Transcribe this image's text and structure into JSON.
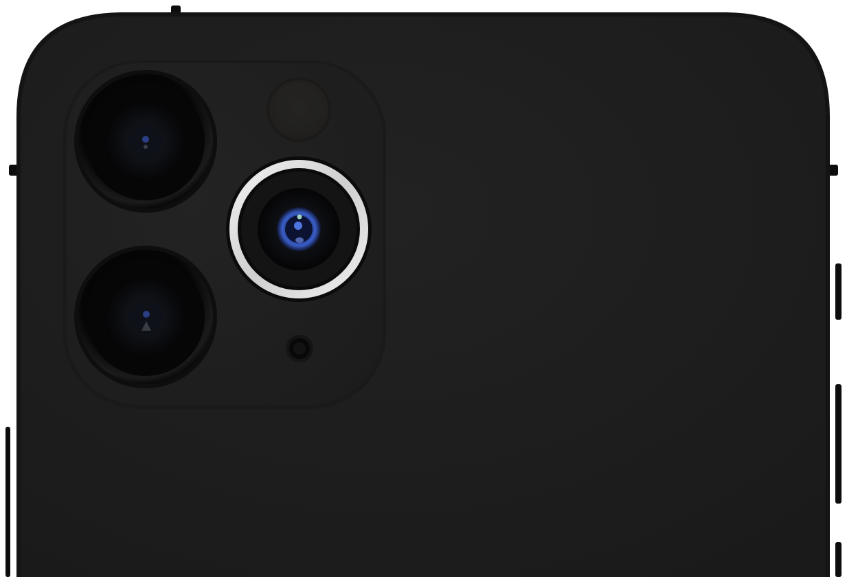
{
  "subject": {
    "kind": "smartphone-rear",
    "camera_count": 3,
    "has_flash": true,
    "has_microphone": true
  },
  "colors": {
    "background": "#ffffff",
    "body": "#1f1f1f",
    "body_edge": "#171717",
    "camera_plateau": "#202020",
    "lens_ring_dark": "#0b0b0b",
    "lens_ring_silver": "#e6e6e6",
    "lens_glass": "#0a0c12",
    "lens_blue": "#2f4fb8",
    "flash": "#262422",
    "buttons": "#0d0d0d"
  },
  "icons": {
    "camera": "camera-lens-icon",
    "flash": "flash-icon",
    "microphone": "microphone-icon"
  }
}
